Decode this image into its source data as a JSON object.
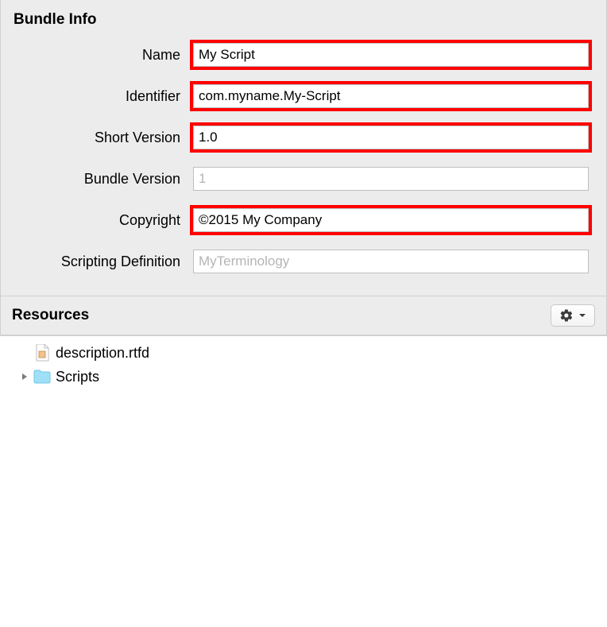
{
  "bundleInfo": {
    "heading": "Bundle Info",
    "fields": {
      "name": {
        "label": "Name",
        "value": "My Script",
        "highlight": true
      },
      "identifier": {
        "label": "Identifier",
        "value": "com.myname.My-Script",
        "highlight": true
      },
      "shortVersion": {
        "label": "Short Version",
        "value": "1.0",
        "highlight": true
      },
      "bundleVersion": {
        "label": "Bundle Version",
        "value": "",
        "placeholder": "1",
        "highlight": false
      },
      "copyright": {
        "label": "Copyright",
        "value": "©2015 My Company",
        "highlight": true
      },
      "scriptingDefinition": {
        "label": "Scripting Definition",
        "value": "",
        "placeholder": "MyTerminology",
        "highlight": false
      }
    }
  },
  "resources": {
    "heading": "Resources",
    "items": [
      {
        "name": "description.rtfd",
        "type": "rtfd"
      },
      {
        "name": "Scripts",
        "type": "folder",
        "expandable": true
      }
    ]
  }
}
